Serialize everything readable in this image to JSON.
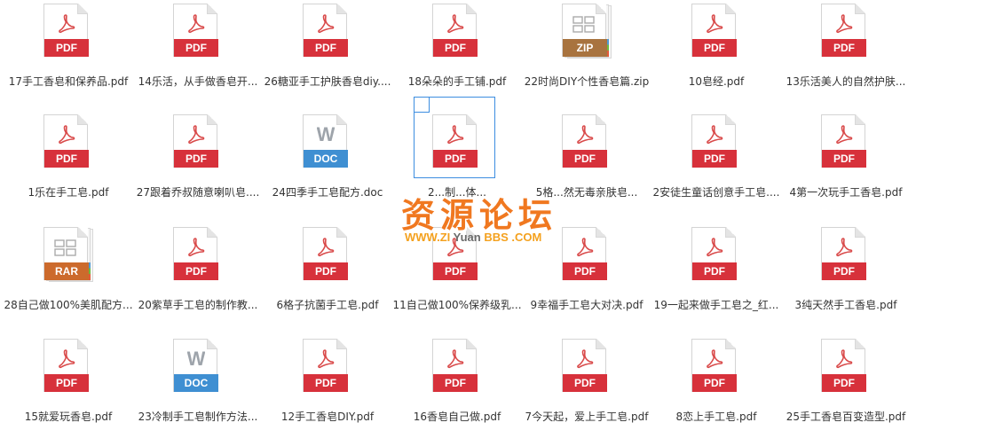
{
  "colors": {
    "pdf": "#d7313b",
    "zip": "#a8733f",
    "doc": "#3f8fd2",
    "rar": "#cc6a2c",
    "pdf_symbol": "#d94a4a",
    "doc_symbol": "#9ea4ab",
    "selection": "#3c8de0",
    "watermark": "#f07820"
  },
  "files": [
    {
      "type": "pdf",
      "badge": "PDF",
      "icon": "acrobat-icon",
      "name": "17手工香皂和保养品.pdf"
    },
    {
      "type": "pdf",
      "badge": "PDF",
      "icon": "acrobat-icon",
      "name": "14乐活，从手做香皂开..."
    },
    {
      "type": "pdf",
      "badge": "PDF",
      "icon": "acrobat-icon",
      "name": "26糖亚手工护肤香皂diy...."
    },
    {
      "type": "pdf",
      "badge": "PDF",
      "icon": "acrobat-icon",
      "name": "18朵朵的手工铺.pdf"
    },
    {
      "type": "zip",
      "badge": "ZIP",
      "icon": "archive-icon",
      "name": "22时尚DIY个性香皂篇.zip"
    },
    {
      "type": "pdf",
      "badge": "PDF",
      "icon": "acrobat-icon",
      "name": "10皂经.pdf"
    },
    {
      "type": "pdf",
      "badge": "PDF",
      "icon": "acrobat-icon",
      "name": "13乐活美人的自然护肤..."
    },
    {
      "type": "pdf",
      "badge": "PDF",
      "icon": "acrobat-icon",
      "name": "1乐在手工皂.pdf"
    },
    {
      "type": "pdf",
      "badge": "PDF",
      "icon": "acrobat-icon",
      "name": "27跟着乔叔随意喇叭皂...."
    },
    {
      "type": "doc",
      "badge": "DOC",
      "icon": "word-icon",
      "name": "24四季手工皂配方.doc"
    },
    {
      "type": "pdf",
      "badge": "PDF",
      "icon": "acrobat-icon",
      "name": "2...制...体..."
    },
    {
      "type": "pdf",
      "badge": "PDF",
      "icon": "acrobat-icon",
      "name": "5格...然无毒亲肤皂..."
    },
    {
      "type": "pdf",
      "badge": "PDF",
      "icon": "acrobat-icon",
      "name": "2安徒生童话创意手工皂...."
    },
    {
      "type": "pdf",
      "badge": "PDF",
      "icon": "acrobat-icon",
      "name": "4第一次玩手工香皂.pdf"
    },
    {
      "type": "rar",
      "badge": "RAR",
      "icon": "archive-icon",
      "name": "28自己做100%美肌配方..."
    },
    {
      "type": "pdf",
      "badge": "PDF",
      "icon": "acrobat-icon",
      "name": "20紫草手工皂的制作教..."
    },
    {
      "type": "pdf",
      "badge": "PDF",
      "icon": "acrobat-icon",
      "name": "6格子抗菌手工皂.pdf"
    },
    {
      "type": "pdf",
      "badge": "PDF",
      "icon": "acrobat-icon",
      "name": "11自己做100%保养级乳..."
    },
    {
      "type": "pdf",
      "badge": "PDF",
      "icon": "acrobat-icon",
      "name": "9幸福手工皂大对决.pdf"
    },
    {
      "type": "pdf",
      "badge": "PDF",
      "icon": "acrobat-icon",
      "name": "19一起来做手工皂之_红..."
    },
    {
      "type": "pdf",
      "badge": "PDF",
      "icon": "acrobat-icon",
      "name": "3纯天然手工香皂.pdf"
    },
    {
      "type": "pdf",
      "badge": "PDF",
      "icon": "acrobat-icon",
      "name": "15就爱玩香皂.pdf"
    },
    {
      "type": "doc",
      "badge": "DOC",
      "icon": "word-icon",
      "name": "23冷制手工皂制作方法..."
    },
    {
      "type": "pdf",
      "badge": "PDF",
      "icon": "acrobat-icon",
      "name": "12手工香皂DIY.pdf"
    },
    {
      "type": "pdf",
      "badge": "PDF",
      "icon": "acrobat-icon",
      "name": "16香皂自己做.pdf"
    },
    {
      "type": "pdf",
      "badge": "PDF",
      "icon": "acrobat-icon",
      "name": "7今天起，爱上手工皂.pdf"
    },
    {
      "type": "pdf",
      "badge": "PDF",
      "icon": "acrobat-icon",
      "name": "8恋上手工皂.pdf"
    },
    {
      "type": "pdf",
      "badge": "PDF",
      "icon": "acrobat-icon",
      "name": "25手工香皂百变造型.pdf"
    }
  ],
  "selected_index": 10,
  "watermark": {
    "title": "资源论坛",
    "url_a": "WWW.",
    "url_b": "ZI",
    "url_c": " Yuan ",
    "url_d": "BBS",
    "url_e": " .COM"
  }
}
